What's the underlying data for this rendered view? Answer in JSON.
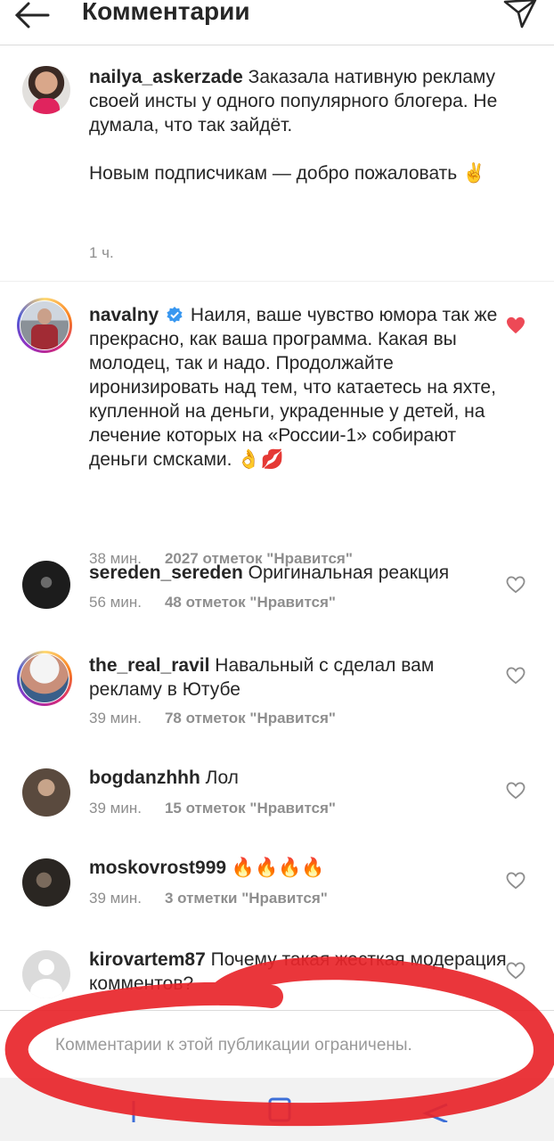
{
  "header": {
    "title": "Комментарии"
  },
  "caption": {
    "username": "nailya_askerzade",
    "text": "Заказала нативную рекламу своей инсты у одного популярного блогера. Не думала, что так зайдёт.",
    "text2": "Новым подписчикам — добро пожаловать ✌️",
    "time": "1 ч."
  },
  "comments": [
    {
      "username": "navalny",
      "verified": true,
      "text": "Наиля, ваше чувство юмора так же прекрасно, как ваша программа. Какая вы молодец, так и надо. Продолжайте иронизировать над тем, что катаетесь на яхте, купленной на деньги, украденные у детей, на лечение которых на «России-1» собирают деньги смсками. 👌💋",
      "time": "38 мин.",
      "likes": "2027 отметок \"Нравится\"",
      "liked": true
    },
    {
      "username": "sereden_sereden",
      "text": "Оригинальная реакция",
      "time": "56 мин.",
      "likes": "48 отметок \"Нравится\"",
      "liked": false
    },
    {
      "username": "the_real_ravil",
      "text": "Навальный с сделал вам рекламу в Ютубе",
      "time": "39 мин.",
      "likes": "78 отметок \"Нравится\"",
      "liked": false
    },
    {
      "username": "bogdanzhhh",
      "text": "Лол",
      "time": "39 мин.",
      "likes": "15 отметок \"Нравится\"",
      "liked": false
    },
    {
      "username": "moskovrost999",
      "text": "🔥🔥🔥🔥",
      "time": "39 мин.",
      "likes": "3 отметки \"Нравится\"",
      "liked": false
    },
    {
      "username": "kirovartem87",
      "text": "Почему такая жесткая модерация комментов?",
      "time": "",
      "likes": "",
      "liked": false
    }
  ],
  "input": {
    "placeholder": "Комментарии к этой публикации ограничены."
  },
  "colors": {
    "like_red": "#ed4956",
    "annotation_red": "#e8252a",
    "verified_blue": "#3897f0",
    "meta_gray": "#8e8e8e"
  },
  "icons": [
    "back-arrow-icon",
    "send-icon",
    "heart-icon",
    "verified-badge-icon",
    "nav-back-icon",
    "nav-home-icon",
    "nav-recent-icon"
  ]
}
